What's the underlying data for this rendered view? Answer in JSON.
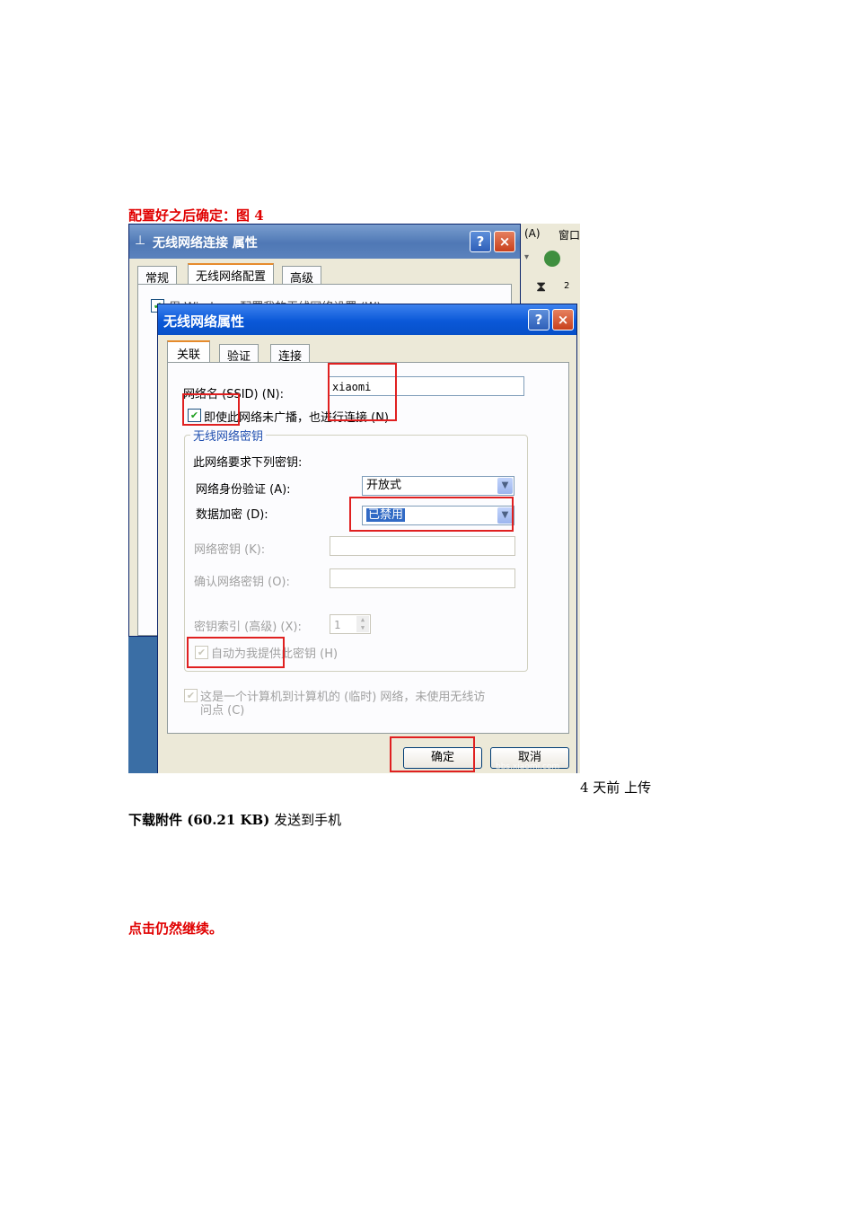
{
  "doc": {
    "heading_fig4": "配置好之后确定：图 4",
    "upload_time": "4 天前 上传",
    "download_bold": "下载附件 (60.21 KB)",
    "download_rest": " 发送到手机",
    "heading_continue": "点击仍然继续。"
  },
  "screenshot": {
    "outer_window": {
      "title": "无线网络连接 属性",
      "tabs": [
        "常规",
        "无线网络配置",
        "高级"
      ],
      "obscured_checkbox_text": "用 Windows 配置我的无线网络设置 (W)"
    },
    "right_strip": {
      "menu_a": "(A)",
      "menu_window": "窗口",
      "number": "2"
    },
    "dialog": {
      "title": "无线网络属性",
      "help_button": "?",
      "close_button": "×",
      "tabs": [
        "关联",
        "验证",
        "连接"
      ],
      "ssid_label": "网络名 (SSID) (N):",
      "ssid_value": "xiaomi",
      "broadcast_checkbox": "即使此网络未广播，也进行连接 (N)",
      "group_title": "无线网络密钥",
      "group_desc": "此网络要求下列密钥:",
      "auth_label": "网络身份验证 (A):",
      "auth_value": "开放式",
      "encryption_label": "数据加密 (D):",
      "encryption_value": "已禁用",
      "key_label": "网络密钥 (K):",
      "confirm_key_label": "确认网络密钥 (O):",
      "key_index_label": "密钥索引 (高级) (X):",
      "key_index_value": "1",
      "auto_key_checkbox": "自动为我提供此密钥 (H)",
      "adhoc_line1": "这是一个计算机到计算机的 (临时) 网络，未使用无线访",
      "adhoc_line2": "问点 (C)",
      "ok_button": "确定",
      "cancel_button": "取消",
      "watermark": "bbs.xiaomi.com"
    },
    "colors": {
      "highlight_red": "#e02020",
      "xp_title_blue": "#0a58d8",
      "xp_face": "#ece9d8"
    }
  }
}
